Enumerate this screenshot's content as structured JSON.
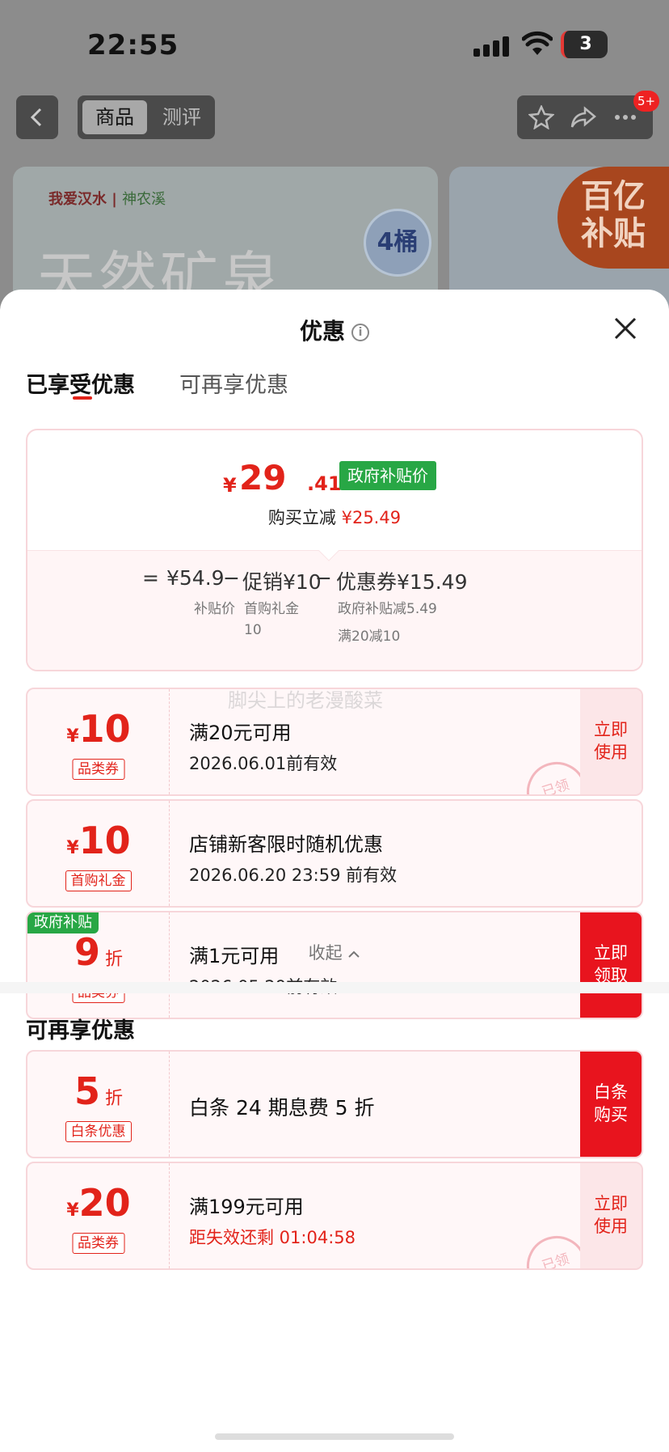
{
  "status_bar": {
    "time": "22:55",
    "battery": "3"
  },
  "nav": {
    "tab_goods": "商品",
    "tab_review": "测评",
    "notification_badge": "5+"
  },
  "background": {
    "brand": "我爱汉水",
    "brand_sub": "神农溪",
    "banner_title": "天然矿泉",
    "bucket_badge": "4桶",
    "subsidy_badge_line1": "百亿",
    "subsidy_badge_line2": "补贴"
  },
  "sheet": {
    "title": "优惠",
    "close_icon": "close-icon",
    "tab_enjoyed": "已享受优惠",
    "tab_more": "可再享优惠"
  },
  "summary": {
    "currency": "¥",
    "price_integer": "29",
    "price_decimal": ".41",
    "price_tag": "政府补贴价",
    "reduce_label": "购买立减",
    "reduce_value": "¥25.49",
    "eq": "=",
    "base_price": "¥54.9",
    "base_label": "补贴价",
    "minus": "−",
    "promo": "促销¥10",
    "promo_sub1": "首购礼金",
    "promo_sub2": "10",
    "coupon": "优惠券¥15.49",
    "coupon_sub1": "政府补贴减5.49",
    "coupon_sub2": "满20减10"
  },
  "coupons": [
    {
      "symbol": "¥",
      "amount": "10",
      "type": "品类券",
      "line1": "满20元可用",
      "line2": "2026.06.01前有效",
      "action": "立即使用",
      "stamp": "已领"
    },
    {
      "symbol": "¥",
      "amount": "10",
      "type": "首购礼金",
      "line1": "店铺新客限时随机优惠",
      "line2": "2026.06.20 23:59 前有效"
    },
    {
      "gov_tag": "政府补贴",
      "amount": "9",
      "unit": "折",
      "type": "品类券",
      "line1": "满1元可用",
      "line2": "2026.05.29前有效",
      "action": "立即领取"
    }
  ],
  "collapse_label": "收起",
  "more_section": {
    "title": "可再享优惠",
    "coupons": [
      {
        "amount": "5",
        "unit": "折",
        "type": "白条优惠",
        "line1": "白条 24 期息费 5 折",
        "action": "白条购买"
      },
      {
        "symbol": "¥",
        "amount": "20",
        "type": "品类券",
        "line1": "满199元可用",
        "line2": "距失效还剩 01:04:58",
        "action": "立即使用",
        "stamp": "已领"
      }
    ]
  },
  "watermark": "脚尖上的老漫酸菜",
  "colors": {
    "accent_red": "#e2231a",
    "gov_green": "#28a745",
    "coupon_bg": "#fff7f8"
  }
}
